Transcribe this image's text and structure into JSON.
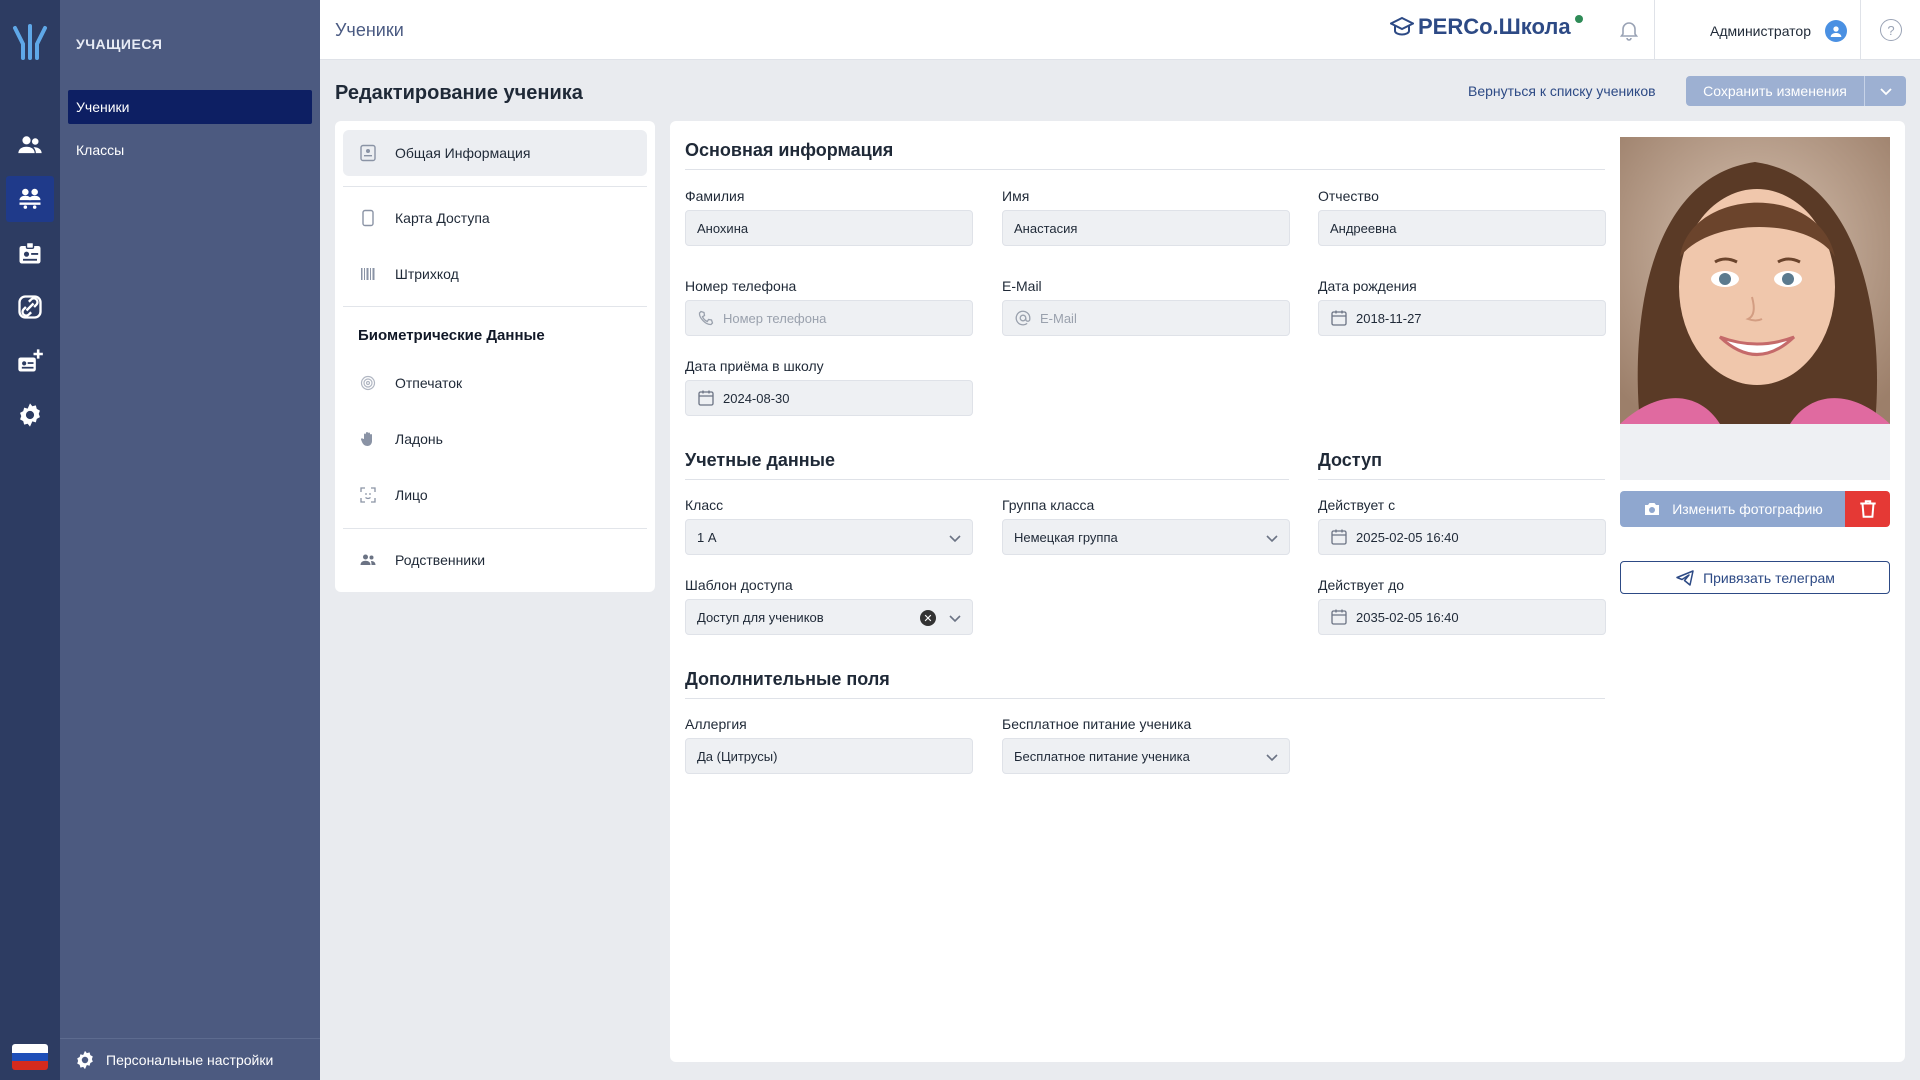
{
  "sidebar": {
    "section_title": "УЧАЩИЕСЯ",
    "items": [
      {
        "label": "Ученики",
        "active": true
      },
      {
        "label": "Классы",
        "active": false
      }
    ],
    "personal_settings": "Персональные настройки"
  },
  "rail": {
    "icons": [
      "users-icon",
      "students-icon",
      "id-card-icon",
      "link-icon",
      "add-card-icon",
      "gear-icon"
    ],
    "active_index": 1
  },
  "header": {
    "title": "Ученики",
    "brand": "PERCo.Школа",
    "user": "Администратор",
    "help": "?"
  },
  "page": {
    "title": "Редактирование ученика",
    "back_link": "Вернуться к списку учеников",
    "save_label": "Сохранить изменения"
  },
  "tabs": {
    "general": "Общая Информация",
    "access_card": "Карта Доступа",
    "barcode": "Штрихкод",
    "biometrics_group": "Биометрические Данные",
    "fingerprint": "Отпечаток",
    "palm": "Ладонь",
    "face": "Лицо",
    "relatives": "Родственники"
  },
  "basic": {
    "title": "Основная информация",
    "last_name_label": "Фамилия",
    "last_name": "Анохина",
    "first_name_label": "Имя",
    "first_name": "Анастасия",
    "patronymic_label": "Отчество",
    "patronymic": "Андреевна",
    "phone_label": "Номер телефона",
    "phone_placeholder": "Номер телефона",
    "email_label": "E-Mail",
    "email_placeholder": "E-Mail",
    "birth_label": "Дата рождения",
    "birth": "2018-11-27",
    "admission_label": "Дата приёма в школу",
    "admission": "2024-08-30"
  },
  "account": {
    "title": "Учетные данные",
    "class_label": "Класс",
    "class_value": "1 А",
    "group_label": "Группа класса",
    "group_value": "Немецкая группа",
    "template_label": "Шаблон доступа",
    "template_value": "Доступ для учеников"
  },
  "access": {
    "title": "Доступ",
    "from_label": "Действует с",
    "from_value": "2025-02-05 16:40",
    "to_label": "Действует до",
    "to_value": "2035-02-05 16:40"
  },
  "extra": {
    "title": "Дополнительные поля",
    "allergy_label": "Аллергия",
    "allergy_value": "Да (Цитрусы)",
    "meal_label": "Бесплатное питание ученика",
    "meal_value": "Бесплатное питание ученика"
  },
  "photo": {
    "change_label": "Изменить фотографию",
    "telegram_label": "Привязать телеграм"
  },
  "colors": {
    "rail": "#2d3c62",
    "sidebar": "#4c5a80",
    "active_nav": "#0d1f63",
    "accent": "#2d4a85",
    "save_button": "#9db0d2",
    "delete_button": "#e53935"
  }
}
